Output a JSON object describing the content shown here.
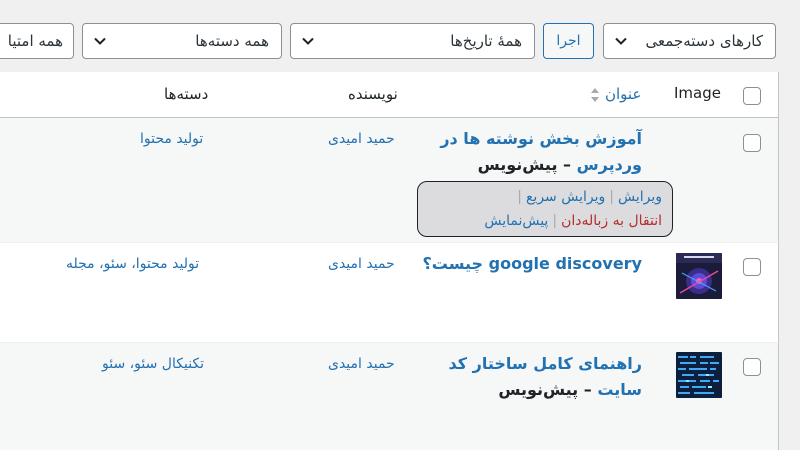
{
  "toolbar": {
    "bulk_actions": "کارهای دسته‌جمعی",
    "apply_label": "اجرا",
    "date_filter": "همهٔ تاریخ‌ها",
    "category_filter": "همه دسته‌ها",
    "rating_filter_partial": "همه امتیا"
  },
  "table": {
    "headers": {
      "image": "Image",
      "title": "عنوان",
      "author": "نویسنده",
      "categories": "دسته‌ها"
    },
    "rows": [
      {
        "title": "آموزش بخش نوشته ها در وردپرس",
        "state": "پیش‌نویس",
        "author": "حمید امیدی",
        "categories": "تولید محتوا",
        "has_thumb": false
      },
      {
        "title": "google discovery چیست؟",
        "state": "",
        "author": "حمید امیدی",
        "categories": "تولید محتوا، سئو، مجله",
        "has_thumb": true,
        "thumb_icon": "google-discovery-thumbnail"
      },
      {
        "title": "راهنمای کامل ساختار کد سایت",
        "state": "پیش‌نویس",
        "author": "حمید امیدی",
        "categories": "تکنیکال سئو، سئو",
        "has_thumb": true,
        "thumb_icon": "site-code-thumbnail"
      }
    ],
    "row_actions": {
      "edit": "ویرایش",
      "quick_edit": "ویرایش سریع",
      "trash": "انتقال به زباله‌دان",
      "preview": "پیش‌نمایش"
    }
  },
  "title_separator": " – ",
  "colors": {
    "link": "#2271b1",
    "trash": "#b32d2e",
    "border": "#c3c4c7",
    "background": "#f0f0f1"
  }
}
